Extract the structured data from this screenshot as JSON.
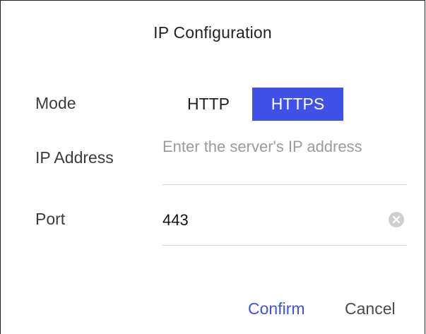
{
  "dialog": {
    "title": "IP Configuration"
  },
  "form": {
    "mode": {
      "label": "Mode",
      "options": [
        "HTTP",
        "HTTPS"
      ],
      "selected": "HTTPS"
    },
    "ip_address": {
      "label": "IP Address",
      "value": "",
      "placeholder": "Enter the server's IP address"
    },
    "port": {
      "label": "Port",
      "value": "443",
      "clear_icon": "clear-circle-icon"
    }
  },
  "actions": {
    "confirm_label": "Confirm",
    "cancel_label": "Cancel"
  },
  "colors": {
    "accent": "#3f51e6",
    "text": "#1f1f1f",
    "placeholder": "#9b9b9b",
    "divider": "#d6d6d6"
  }
}
